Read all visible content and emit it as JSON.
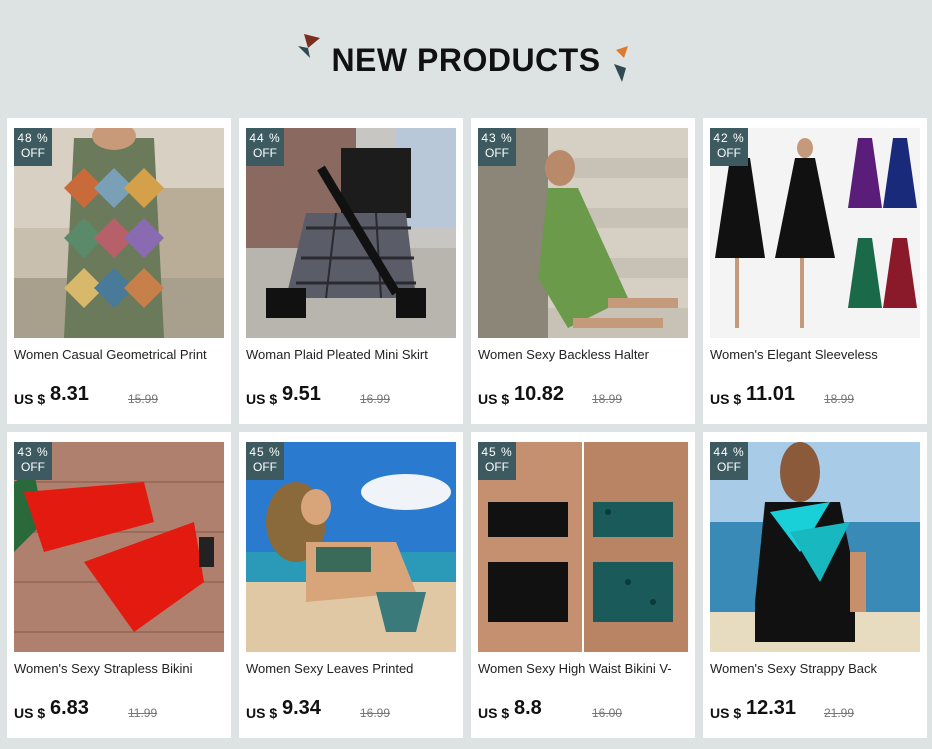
{
  "header": {
    "title": "NEW PRODUCTS"
  },
  "badge_suffix": "OFF",
  "currency": "US $",
  "products": [
    {
      "discount": "48 %",
      "name": "Women Casual Geometrical Print",
      "price": "8.31",
      "old_price": "15.99"
    },
    {
      "discount": "44 %",
      "name": "Woman Plaid Pleated Mini Skirt",
      "price": "9.51",
      "old_price": "16.99"
    },
    {
      "discount": "43 %",
      "name": "Women Sexy Backless Halter",
      "price": "10.82",
      "old_price": "18.99"
    },
    {
      "discount": "42 %",
      "name": "Women's Elegant Sleeveless",
      "price": "11.01",
      "old_price": "18.99"
    },
    {
      "discount": "43 %",
      "name": "Women's Sexy Strapless Bikini",
      "price": "6.83",
      "old_price": "11.99"
    },
    {
      "discount": "45 %",
      "name": "Women Sexy Leaves Printed",
      "price": "9.34",
      "old_price": "16.99"
    },
    {
      "discount": "45 %",
      "name": "Women Sexy High Waist Bikini V-",
      "price": "8.8",
      "old_price": "16.00"
    },
    {
      "discount": "44 %",
      "name": "Women's Sexy Strappy Back",
      "price": "12.31",
      "old_price": "21.99"
    }
  ]
}
